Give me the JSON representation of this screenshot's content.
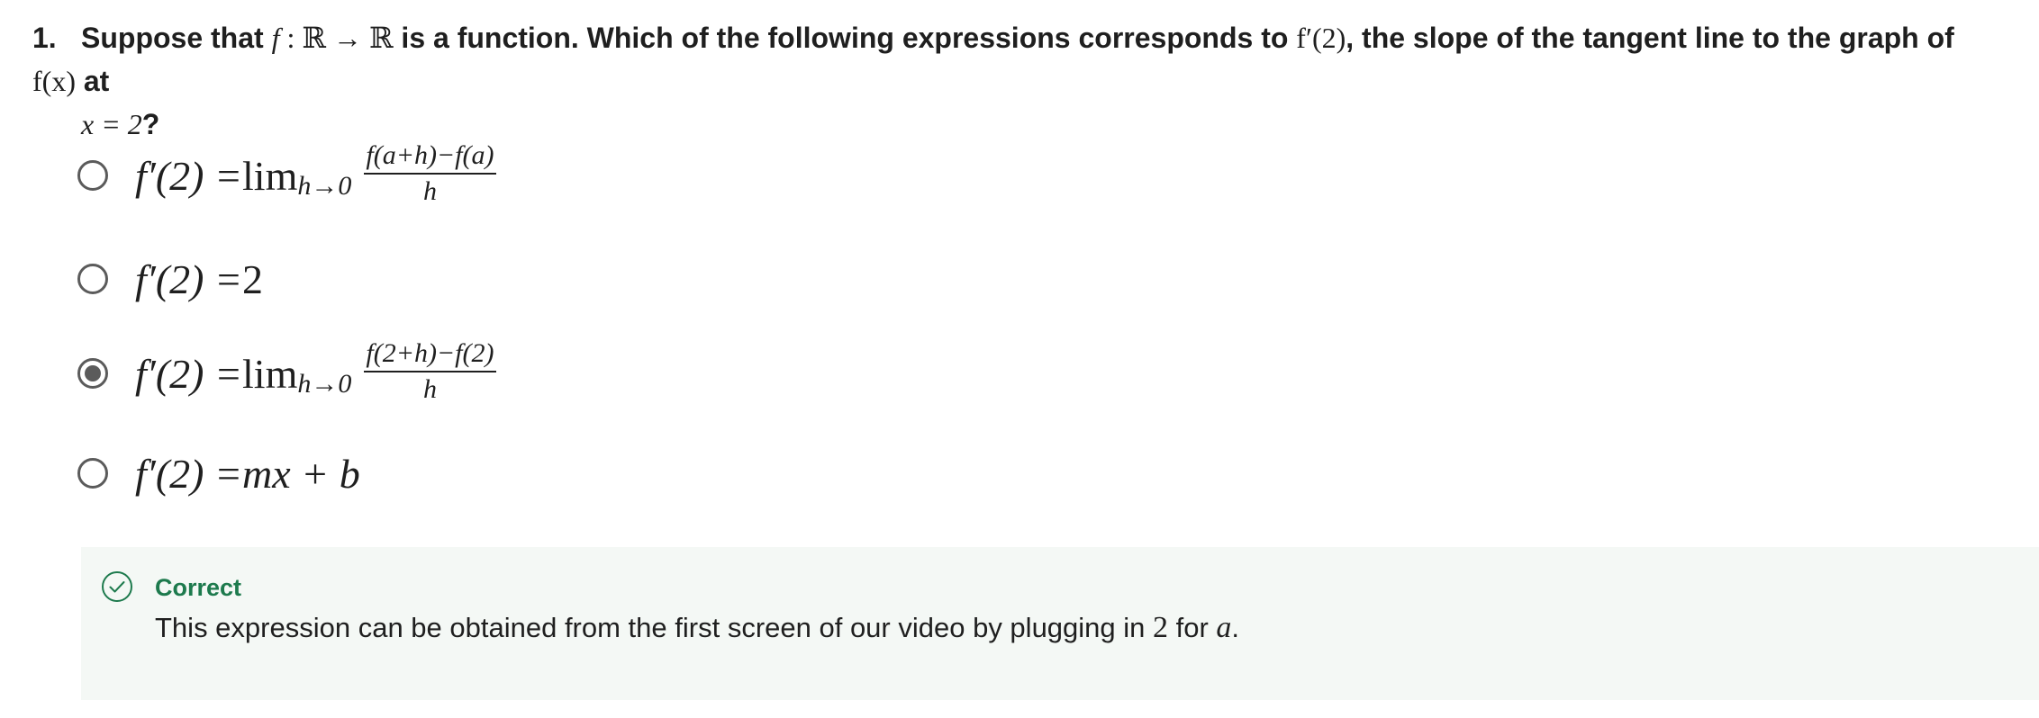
{
  "question": {
    "number": "1.",
    "text_part1": "Suppose that ",
    "math_f": "f",
    "math_map": " : ℝ → ℝ",
    "text_part2": " is a function. Which of the following expressions corresponds to ",
    "math_fprime2": "f′(2)",
    "text_part3": ", the slope of the tangent line to the graph of ",
    "math_fx": "f(x)",
    "text_part4": " at",
    "math_x_eq_2": "x = 2",
    "text_part5": "?"
  },
  "options": [
    {
      "selected": false,
      "lhs": "f′(2) = ",
      "lim": "lim",
      "lim_sub": "h→0",
      "numerator": "f(a+h)−f(a)",
      "denominator": "h"
    },
    {
      "selected": false,
      "lhs": "f′(2) = ",
      "rhs": "2"
    },
    {
      "selected": true,
      "lhs": "f′(2) = ",
      "lim": "lim",
      "lim_sub": "h→0",
      "numerator": "f(2+h)−f(2)",
      "denominator": "h"
    },
    {
      "selected": false,
      "lhs": "f′(2) = ",
      "rhs": "mx + b"
    }
  ],
  "feedback": {
    "status": "Correct",
    "text_part1": "This expression can be obtained from the first screen of our video by plugging in ",
    "math_2": "2",
    "text_part2": " for ",
    "math_a": "a",
    "text_part3": "."
  },
  "colors": {
    "correct_green": "#1d7a4d",
    "feedback_bg": "#f4f8f5",
    "radio_gray": "#5b5b5b"
  },
  "icons": {
    "radio_unselected": "radio-unselected-icon",
    "radio_selected": "radio-selected-icon",
    "feedback": "check-circle-icon"
  }
}
